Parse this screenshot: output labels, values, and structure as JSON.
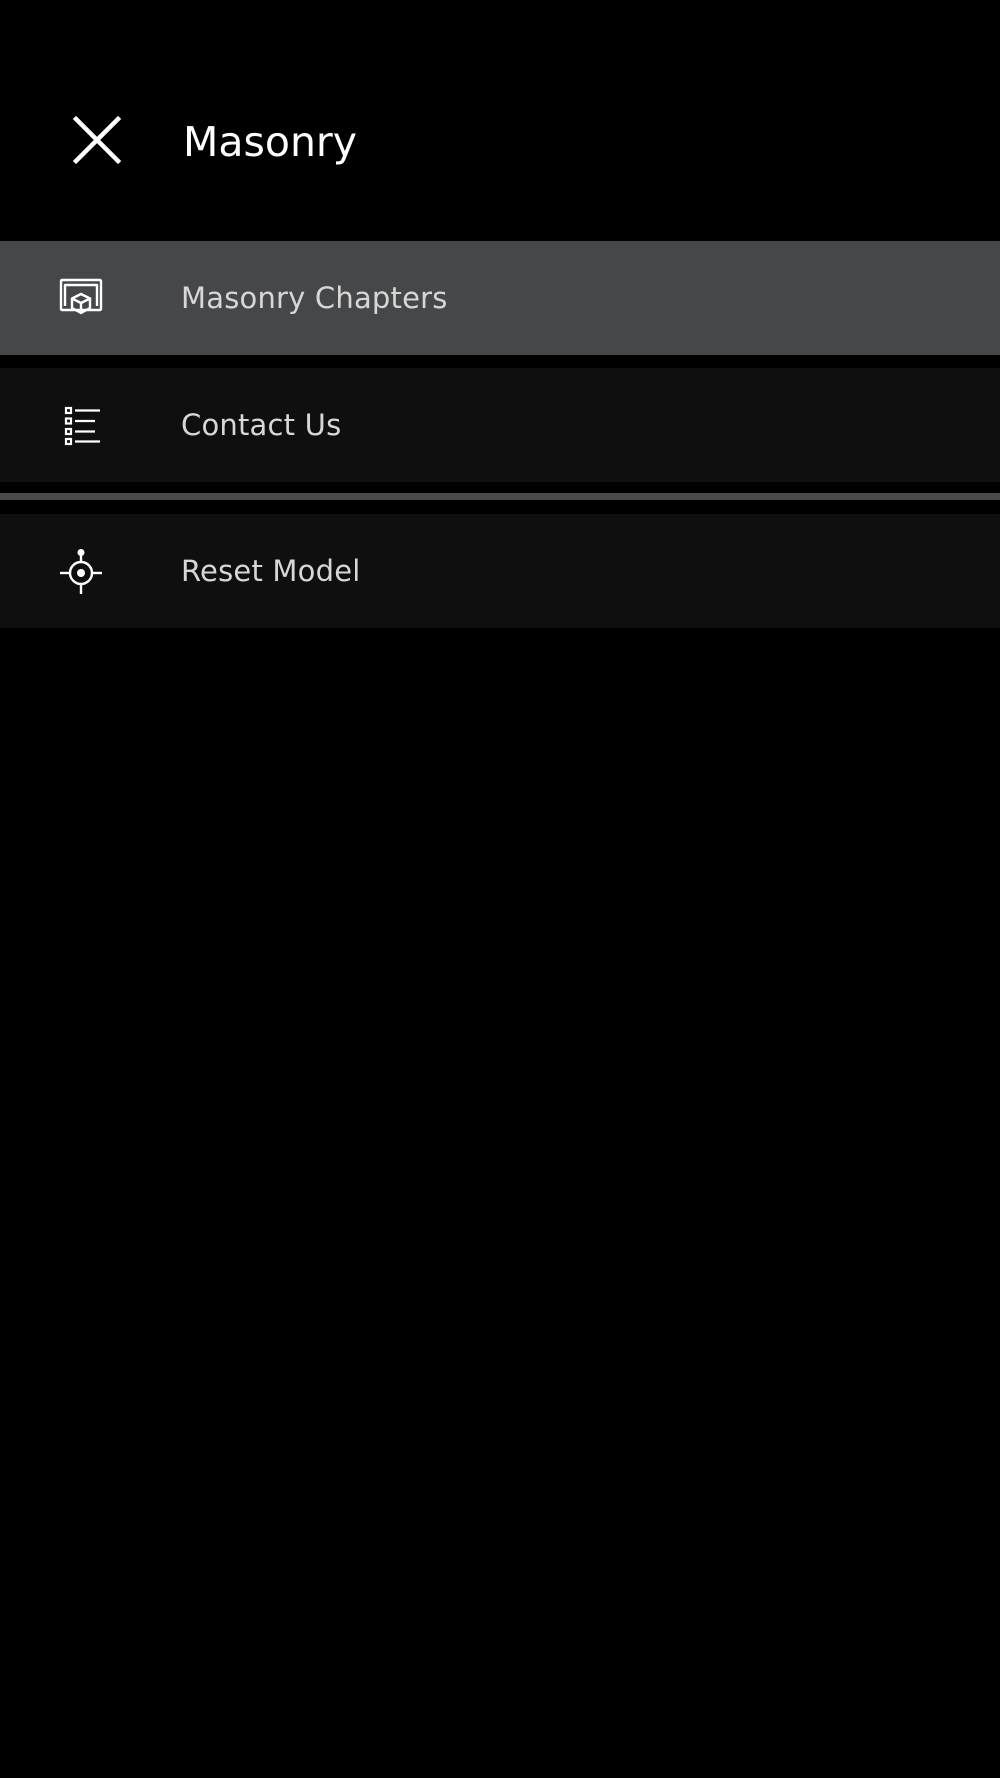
{
  "header": {
    "title": "Masonry",
    "close_icon": "close-icon"
  },
  "menu": {
    "items": [
      {
        "label": "Masonry Chapters",
        "icon": "model-chapters-icon",
        "selected": true
      },
      {
        "label": "Contact Us",
        "icon": "list-icon",
        "selected": false
      },
      {
        "label": "Reset Model",
        "icon": "reset-target-icon",
        "selected": false
      }
    ]
  },
  "colors": {
    "background": "#000000",
    "item_background": "#0f0f0f",
    "selected_background": "#464749",
    "divider": "#4a4a4a",
    "text": "#d7d7d7",
    "title": "#ffffff"
  }
}
